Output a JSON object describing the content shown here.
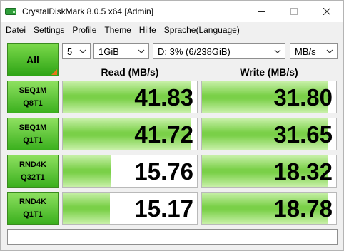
{
  "window": {
    "title": "CrystalDiskMark 8.0.5 x64 [Admin]"
  },
  "menu": [
    "Datei",
    "Settings",
    "Profile",
    "Theme",
    "Hilfe",
    "Sprache(Language)"
  ],
  "controls": {
    "all_label": "All",
    "count": "5",
    "size": "1GiB",
    "drive": "D: 3% (6/238GiB)",
    "unit": "MB/s"
  },
  "headers": {
    "read": "Read (MB/s)",
    "write": "Write (MB/s)"
  },
  "tests": [
    {
      "line1": "SEQ1M",
      "line2": "Q8T1",
      "read": "41.83",
      "write": "31.80",
      "read_fill": 0.95,
      "write_fill": 0.94
    },
    {
      "line1": "SEQ1M",
      "line2": "Q1T1",
      "read": "41.72",
      "write": "31.65",
      "read_fill": 0.95,
      "write_fill": 0.94
    },
    {
      "line1": "RND4K",
      "line2": "Q32T1",
      "read": "15.76",
      "write": "18.32",
      "read_fill": 0.36,
      "write_fill": 0.94
    },
    {
      "line1": "RND4K",
      "line2": "Q1T1",
      "read": "15.17",
      "write": "18.78",
      "read_fill": 0.35,
      "write_fill": 0.94
    }
  ],
  "status_text": "",
  "colors": {
    "button_green": "#3bb01e",
    "bar_green": "#7ad048",
    "corner_orange": "#e8741a"
  }
}
